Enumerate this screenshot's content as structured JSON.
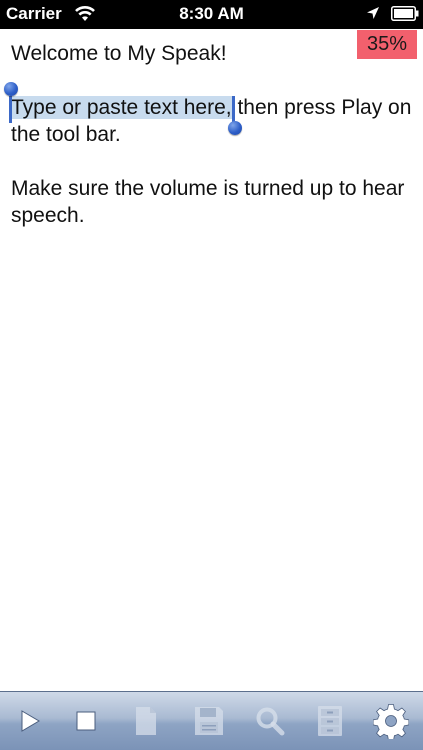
{
  "status_bar": {
    "carrier": "Carrier",
    "time": "8:30 AM",
    "icons": [
      "wifi-icon",
      "location-arrow-icon",
      "battery-icon"
    ]
  },
  "editor": {
    "progress_percent": "35%",
    "progress_color": "#f2606d",
    "selection_color": "#c8dbee",
    "handle_color": "#2e5fc8",
    "line1": "Welcome to My Speak!",
    "selected_text": "Type or paste text here,",
    "line2_rest": " then press Play on the tool bar.",
    "line3": "Make sure the volume is turned up to hear speech."
  },
  "toolbar": {
    "buttons": [
      {
        "icon": "play-icon",
        "enabled": true
      },
      {
        "icon": "stop-icon",
        "enabled": true
      },
      {
        "icon": "new-document-icon",
        "enabled": false
      },
      {
        "icon": "save-disk-icon",
        "enabled": false
      },
      {
        "icon": "search-icon",
        "enabled": false
      },
      {
        "icon": "file-cabinet-icon",
        "enabled": false
      },
      {
        "icon": "gear-icon",
        "enabled": true
      }
    ]
  }
}
